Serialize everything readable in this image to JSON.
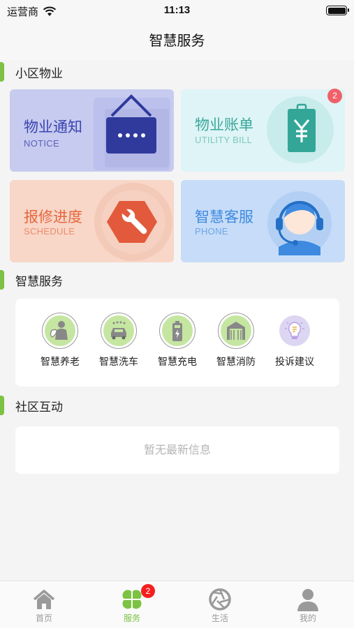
{
  "status_bar": {
    "carrier": "运营商",
    "time": "11:13"
  },
  "nav": {
    "title": "智慧服务"
  },
  "sections": {
    "property": "小区物业",
    "services": "智慧服务",
    "community": "社区互动"
  },
  "property_cards": [
    {
      "title": "物业通知",
      "subtitle": "NOTICE",
      "icon": "bulletin-board-icon"
    },
    {
      "title": "物业账单",
      "subtitle": "UTILITY BILL",
      "icon": "yen-bill-icon",
      "badge": "2"
    },
    {
      "title": "报修进度",
      "subtitle": "SCHEDULE",
      "icon": "wrench-icon"
    },
    {
      "title": "智慧客服",
      "subtitle": "PHONE",
      "icon": "headset-agent-icon"
    }
  ],
  "services": [
    {
      "label": "智慧养老",
      "icon": "elderly-care-icon"
    },
    {
      "label": "智慧洗车",
      "icon": "car-wash-icon"
    },
    {
      "label": "智慧充电",
      "icon": "battery-charge-icon"
    },
    {
      "label": "智慧消防",
      "icon": "fire-station-icon"
    },
    {
      "label": "投诉建议",
      "icon": "lightbulb-icon"
    }
  ],
  "community": {
    "empty_text": "暂无最新信息"
  },
  "tabs": [
    {
      "label": "首页",
      "icon": "home-icon",
      "active": false
    },
    {
      "label": "服务",
      "icon": "clover-icon",
      "active": true,
      "badge": "2"
    },
    {
      "label": "生活",
      "icon": "aperture-icon",
      "active": false
    },
    {
      "label": "我的",
      "icon": "user-icon",
      "active": false
    }
  ],
  "colors": {
    "accent_green": "#7cc243",
    "notice": "#3a44b0",
    "bill": "#3aa89b",
    "repair": "#e5673d",
    "phone": "#3d8ae0",
    "badge_red": "#f51f1f"
  }
}
